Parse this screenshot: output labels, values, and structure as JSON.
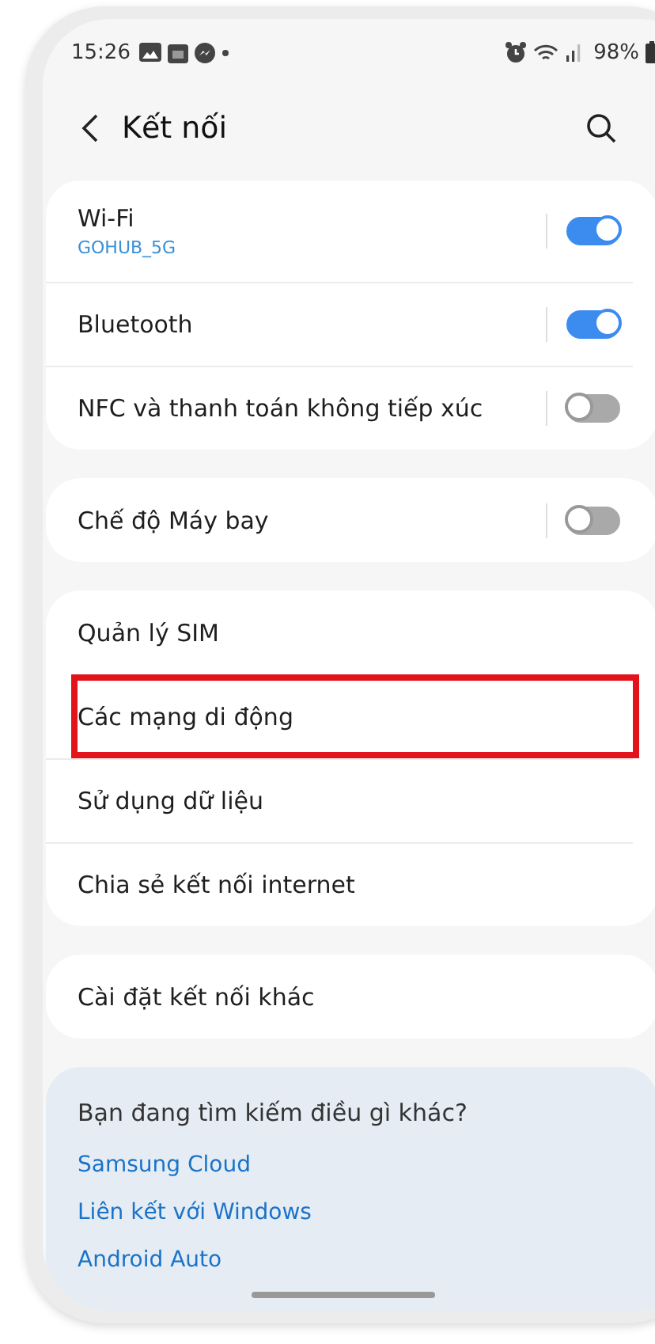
{
  "status_bar": {
    "time": "15:26",
    "battery": "98%"
  },
  "header": {
    "title": "Kết nối"
  },
  "groups": [
    {
      "items": [
        {
          "label": "Wi-Fi",
          "subtitle": "GOHUB_5G",
          "kind": "toggle",
          "on": true,
          "highlighted": false
        },
        {
          "label": "Bluetooth",
          "kind": "toggle",
          "on": true,
          "highlighted": false
        },
        {
          "label": "NFC và thanh toán không tiếp xúc",
          "kind": "toggle",
          "on": false,
          "highlighted": false
        }
      ]
    },
    {
      "items": [
        {
          "label": "Chế độ Máy bay",
          "kind": "toggle",
          "on": false,
          "highlighted": false
        }
      ]
    },
    {
      "items": [
        {
          "label": "Quản lý SIM",
          "kind": "link",
          "highlighted": false
        },
        {
          "label": "Các mạng di động",
          "kind": "link",
          "highlighted": true
        },
        {
          "label": "Sử dụng dữ liệu",
          "kind": "link",
          "highlighted": false
        },
        {
          "label": "Chia sẻ kết nối internet",
          "kind": "link",
          "highlighted": false
        }
      ]
    },
    {
      "items": [
        {
          "label": "Cài đặt kết nối khác",
          "kind": "link",
          "highlighted": false
        }
      ]
    }
  ],
  "help": {
    "title": "Bạn đang tìm kiếm điều gì khác?",
    "links": [
      "Samsung Cloud",
      "Liên kết với Windows",
      "Android Auto"
    ]
  }
}
